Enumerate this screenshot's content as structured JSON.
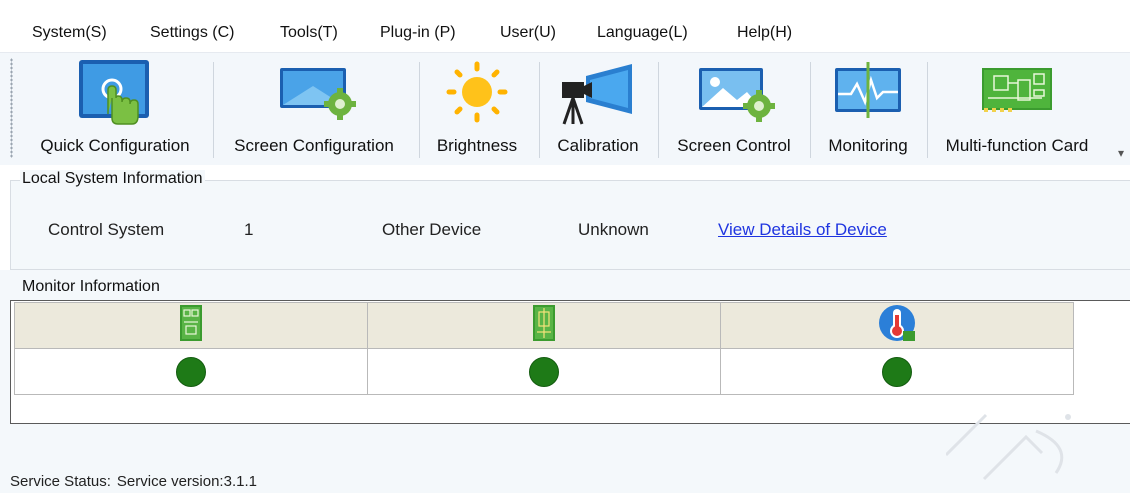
{
  "menu": {
    "items": [
      {
        "label": "System(S)"
      },
      {
        "label": "Settings (C)"
      },
      {
        "label": "Tools(T)"
      },
      {
        "label": "Plug-in (P)"
      },
      {
        "label": "User(U)"
      },
      {
        "label": "Language(L)"
      },
      {
        "label": "Help(H)"
      }
    ]
  },
  "toolbar": {
    "buttons": [
      {
        "label": "Quick Configuration",
        "icon": "touch-monitor-icon"
      },
      {
        "label": "Screen Configuration",
        "icon": "screen-gear-icon"
      },
      {
        "label": "Brightness",
        "icon": "sun-icon"
      },
      {
        "label": "Calibration",
        "icon": "camera-screen-icon"
      },
      {
        "label": "Screen Control",
        "icon": "screen-image-gear-icon"
      },
      {
        "label": "Monitoring",
        "icon": "waveform-monitor-icon"
      },
      {
        "label": "Multi-function Card",
        "icon": "circuit-board-icon"
      }
    ]
  },
  "local_system": {
    "title": "Local System Information",
    "control_system_label": "Control System",
    "control_system_value": "1",
    "other_device_label": "Other Device",
    "other_device_value": "Unknown",
    "details_link": "View Details of Device"
  },
  "monitor": {
    "title": "Monitor Information",
    "columns": [
      {
        "icon": "receiving-card-icon",
        "status": "ok"
      },
      {
        "icon": "multifunction-card-icon",
        "status": "ok"
      },
      {
        "icon": "thermometer-icon",
        "status": "ok"
      }
    ],
    "status_color": "#1e7a17"
  },
  "status_bar": {
    "label": "Service Status:",
    "value": "Service version:3.1.1"
  }
}
